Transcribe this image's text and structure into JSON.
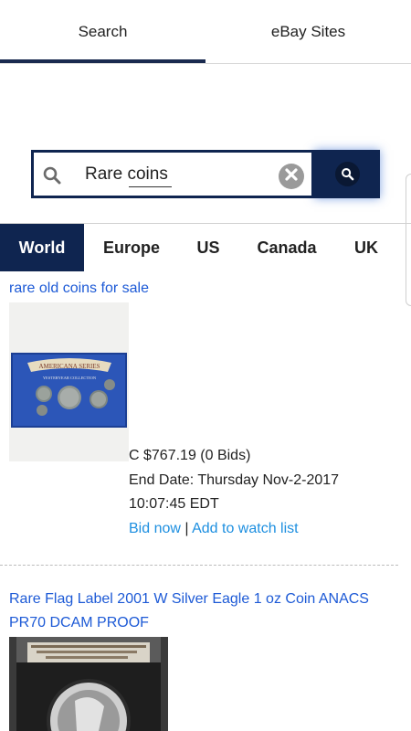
{
  "tabs": [
    {
      "label": "Search",
      "active": true
    },
    {
      "label": "eBay Sites",
      "active": false
    }
  ],
  "search": {
    "value": "Rare coins",
    "clear_icon": "clear-circle-icon",
    "search_icon": "search-icon"
  },
  "regions": [
    "World",
    "Europe",
    "US",
    "Canada",
    "UK"
  ],
  "active_region": "World",
  "listings": [
    {
      "title": "rare old coins for sale",
      "price": "C $767.19 (0 Bids)",
      "end_date": "End Date: Thursday Nov-2-2017",
      "end_time": "10:07:45 EDT",
      "bid_label": "Bid now",
      "separator": "|",
      "watch_label": "Add to watch list",
      "image_text_banner": "AMERICANA SERIES",
      "image_text_sub": "YESTERYEAR COLLECTION"
    },
    {
      "title_line1": "Rare Flag Label 2001 W Silver Eagle 1 oz Coin ANACS",
      "title_line2": "PR70 DCAM PROOF"
    }
  ],
  "colors": {
    "navy": "#0f2550",
    "link": "#1d5ad6",
    "action_link": "#1d8fe0"
  }
}
